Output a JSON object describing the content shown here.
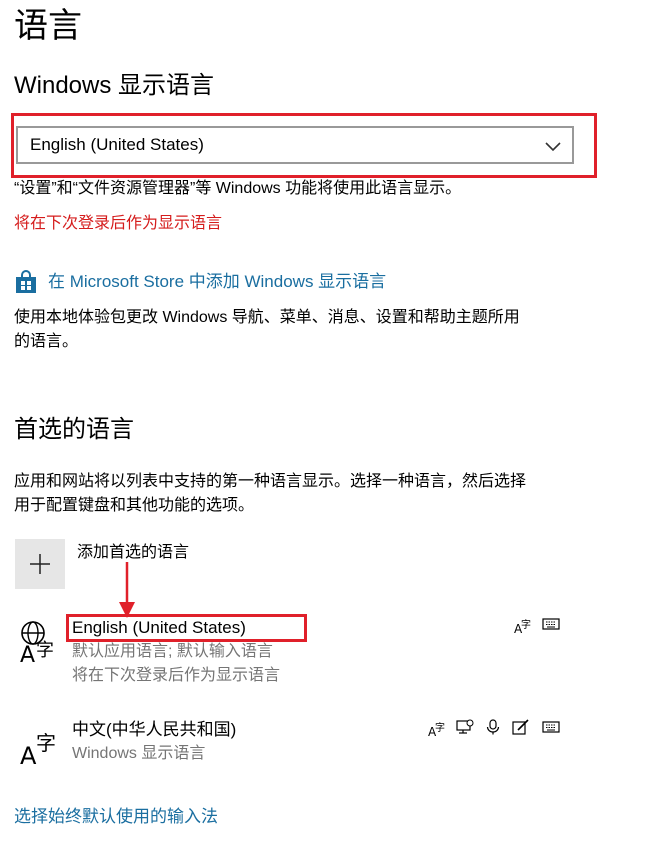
{
  "page": {
    "title": "语言"
  },
  "display_language": {
    "heading": "Windows 显示语言",
    "selected": "English (United States)",
    "description": "“设置”和“文件资源管理器”等 Windows 功能将使用此语言显示。",
    "pending_notice": "将在下次登录后作为显示语言",
    "store_link": "在 Microsoft Store 中添加 Windows 显示语言",
    "store_description_line1": "使用本地体验包更改 Windows 导航、菜单、消息、设置和帮助主题所用",
    "store_description_line2": "的语言。"
  },
  "preferred_languages": {
    "heading": "首选的语言",
    "description_line1": "应用和网站将以列表中支持的第一种语言显示。选择一种语言，然后选择",
    "description_line2": "用于配置键盘和其他功能的选项。",
    "add_label": "添加首选的语言",
    "items": [
      {
        "name": "English (United States)",
        "sub1": "默认应用语言; 默认输入语言",
        "sub2": "将在下次登录后作为显示语言",
        "features": [
          "language-pack-icon",
          "keyboard-icon"
        ]
      },
      {
        "name": "中文(中华人民共和国)",
        "sub1": "Windows 显示语言",
        "features": [
          "language-pack-icon",
          "speech-icon",
          "microphone-icon",
          "handwriting-icon",
          "keyboard-icon"
        ]
      }
    ]
  },
  "footer": {
    "input_link": "选择始终默认使用的输入法"
  },
  "colors": {
    "highlight_red": "#e0202a",
    "link_blue": "#1a6ea0",
    "notice_red": "#d51c1c",
    "secondary_gray": "#757575"
  }
}
